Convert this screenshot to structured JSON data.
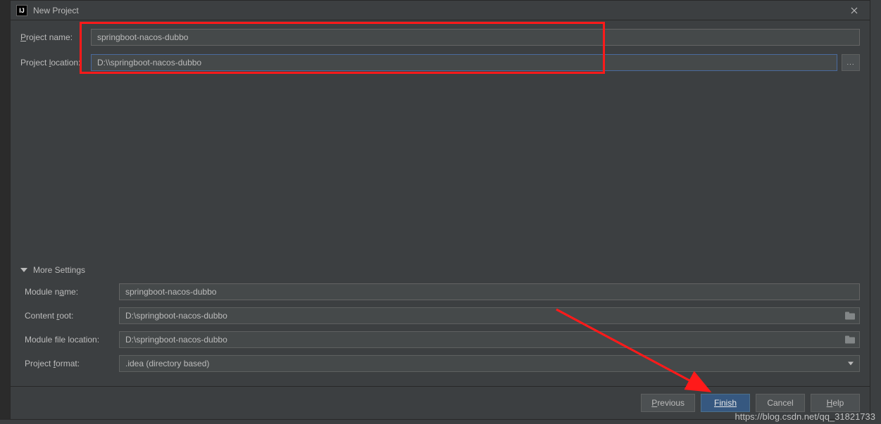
{
  "titlebar": {
    "title": "New Project"
  },
  "form": {
    "project_name_label": "Project name:",
    "project_name_value": "springboot-nacos-dubbo",
    "project_location_label_pre": "Project ",
    "project_location_label_underline": "l",
    "project_location_label_post": "ocation:",
    "project_location_value": "D:\\\\springboot-nacos-dubbo",
    "browse_label": "..."
  },
  "more_settings": {
    "header": "More Settings",
    "module_name_label_pre": "Module n",
    "module_name_label_underline": "a",
    "module_name_label_post": "me:",
    "module_name_value": "springboot-nacos-dubbo",
    "content_root_label_pre": "Content ",
    "content_root_label_underline": "r",
    "content_root_label_post": "oot:",
    "content_root_value": "D:\\springboot-nacos-dubbo",
    "module_file_location_label": "Module file location:",
    "module_file_location_value": "D:\\springboot-nacos-dubbo",
    "project_format_label_pre": "Project ",
    "project_format_label_underline": "f",
    "project_format_label_post": "ormat:",
    "project_format_value": ".idea (directory based)"
  },
  "buttons": {
    "previous_pre": "P",
    "previous_post": "revious",
    "finish": "Finish",
    "cancel": "Cancel",
    "help_pre": "H",
    "help_post": "elp"
  },
  "watermark": "https://blog.csdn.net/qq_31821733"
}
